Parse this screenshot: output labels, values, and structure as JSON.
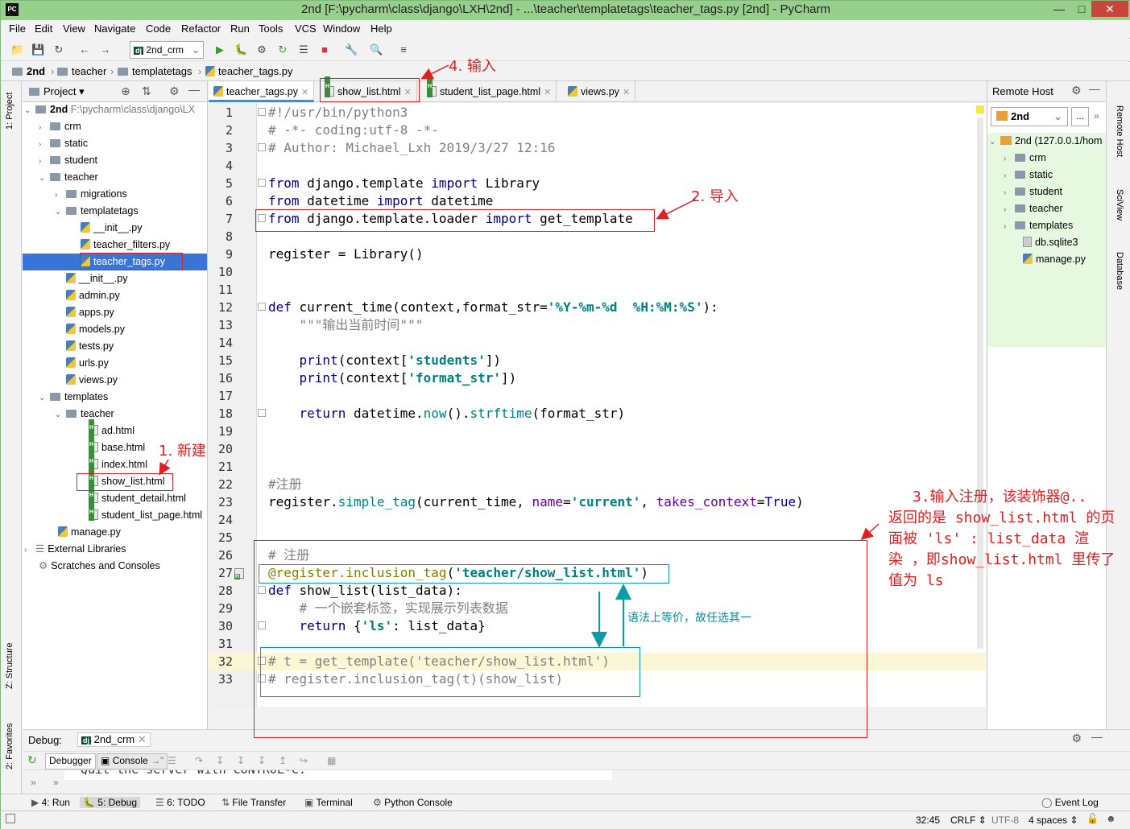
{
  "title": "2nd [F:\\pycharm\\class\\django\\LXH\\2nd] - ...\\teacher\\templatetags\\teacher_tags.py [2nd] - PyCharm",
  "menu": [
    "File",
    "Edit",
    "View",
    "Navigate",
    "Code",
    "Refactor",
    "Run",
    "Tools",
    "VCS",
    "Window",
    "Help"
  ],
  "toolbar": {
    "run_config": "2nd_crm"
  },
  "breadcrumb": [
    "2nd",
    "teacher",
    "templatetags",
    "teacher_tags.py"
  ],
  "left_strip": {
    "project": "1: Project",
    "structure": "Z: Structure",
    "favorites": "2: Favorites"
  },
  "project_panel": {
    "title": "Project",
    "tree": [
      {
        "label": "2nd",
        "extra": "F:\\pycharm\\class\\django\\LX"
      },
      {
        "label": "crm"
      },
      {
        "label": "static"
      },
      {
        "label": "student"
      },
      {
        "label": "teacher"
      },
      {
        "label": "migrations"
      },
      {
        "label": "templatetags"
      },
      {
        "label": "__init__.py"
      },
      {
        "label": "teacher_filters.py"
      },
      {
        "label": "teacher_tags.py"
      },
      {
        "label": "__init__.py"
      },
      {
        "label": "admin.py"
      },
      {
        "label": "apps.py"
      },
      {
        "label": "models.py"
      },
      {
        "label": "tests.py"
      },
      {
        "label": "urls.py"
      },
      {
        "label": "views.py"
      },
      {
        "label": "templates"
      },
      {
        "label": "teacher"
      },
      {
        "label": "ad.html"
      },
      {
        "label": "base.html"
      },
      {
        "label": "index.html"
      },
      {
        "label": "show_list.html"
      },
      {
        "label": "student_detail.html"
      },
      {
        "label": "student_list_page.html"
      },
      {
        "label": "manage.py"
      },
      {
        "label": "External Libraries"
      },
      {
        "label": "Scratches and Consoles"
      }
    ]
  },
  "tabs": [
    "teacher_tags.py",
    "show_list.html",
    "student_list_page.html",
    "views.py"
  ],
  "code_lines": [
    "#!/usr/bin/python3",
    "# -*- coding:utf-8 -*-",
    "# Author: Michael_Lxh 2019/3/27 12:16",
    "",
    "from django.template import Library",
    "from datetime import datetime",
    "from django.template.loader import get_template",
    "",
    "register = Library()",
    "",
    "",
    "def current_time(context,format_str='%Y-%m-%d  %H:%M:%S'):",
    "    \"\"\"输出当前时间\"\"\"",
    "",
    "    print(context['students'])",
    "    print(context['format_str'])",
    "",
    "    return datetime.now().strftime(format_str)",
    "",
    "",
    "",
    "#注册",
    "register.simple_tag(current_time, name='current', takes_context=True)",
    "",
    "",
    "# 注册",
    "@register.inclusion_tag('teacher/show_list.html')",
    "def show_list(list_data):",
    "    # 一个嵌套标签，实现展示列表数据",
    "    return {'ls': list_data}",
    "",
    "# t = get_template('teacher/show_list.html')",
    "# register.inclusion_tag(t)(show_list)"
  ],
  "right_panel": {
    "title": "Remote Host",
    "server": "2nd",
    "root": "2nd (127.0.0.1/hom",
    "items": [
      "crm",
      "static",
      "student",
      "teacher",
      "templates",
      "db.sqlite3",
      "manage.py"
    ]
  },
  "right_strip": {
    "remote_host": "Remote Host",
    "sciview": "SciView",
    "database": "Database"
  },
  "debug": {
    "label": "Debug:",
    "config": "2nd_crm",
    "tab_debugger": "Debugger",
    "tab_console": "Console",
    "output": "Quit the server with CONTROL-C."
  },
  "bottom_tabs": [
    "4: Run",
    "5: Debug",
    "6: TODO",
    "File Transfer",
    "Terminal",
    "Python Console"
  ],
  "event_log": "Event Log",
  "status": {
    "position": "32:45",
    "line_sep": "CRLF",
    "encoding": "UTF-8",
    "indent": "4 spaces"
  },
  "annotations": {
    "a1": "1. 新建",
    "a2": "2. 导入",
    "a3_lines": [
      "3.输入注册，该装饰器@..",
      "返回的是 show_list.html 的页",
      "面被 'ls' : list_data 渲",
      "染 ，即show_list.html 里传了",
      "值为 ls"
    ],
    "a4": "4. 输入",
    "equiv": "语法上等价，故任选其一"
  }
}
